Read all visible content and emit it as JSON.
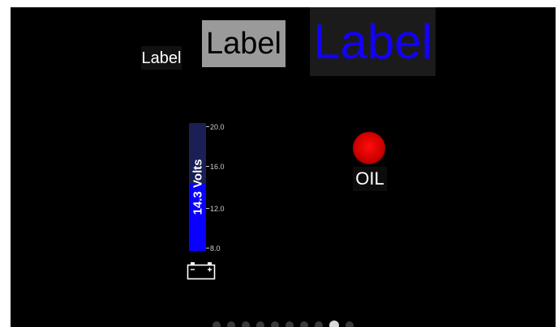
{
  "labels": {
    "small": "Label",
    "medium": "Label",
    "large": "Label",
    "large_color": "#1400ff"
  },
  "volt_meter": {
    "readout": "14.3 Volts",
    "value": 14.3,
    "min": 8.0,
    "max": 20.0,
    "ticks": [
      "20.0",
      "16.0",
      "12.0",
      "8.0"
    ],
    "fill_color": "#0a00ff",
    "track_color": "#1a1f55",
    "icon": "battery-icon"
  },
  "warning_light": {
    "label": "OIL",
    "color": "#ff0000",
    "state": "on"
  },
  "pager": {
    "count": 10,
    "active_index": 8
  }
}
